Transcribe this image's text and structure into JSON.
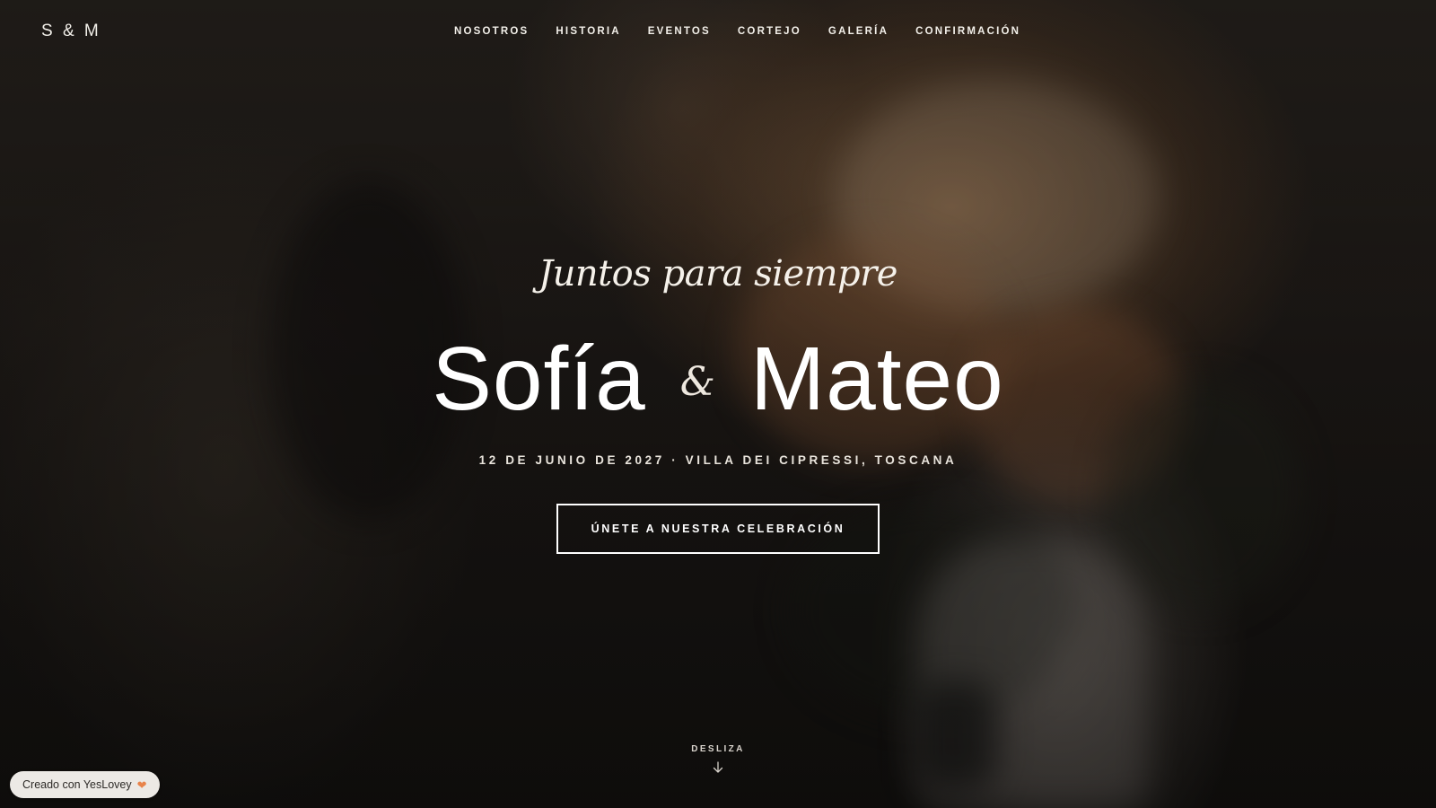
{
  "header": {
    "logo": "S & M",
    "nav": [
      {
        "label": "NOSOTROS"
      },
      {
        "label": "HISTORIA"
      },
      {
        "label": "EVENTOS"
      },
      {
        "label": "CORTEJO"
      },
      {
        "label": "GALERÍA"
      },
      {
        "label": "CONFIRMACIÓN"
      }
    ]
  },
  "hero": {
    "tagline": "Juntos para siempre",
    "name_one": "Sofía",
    "ampersand": "&",
    "name_two": "Mateo",
    "details": "12 DE JUNIO DE 2027 · VILLA DEI CIPRESSI, TOSCANA",
    "cta_label": "ÚNETE A NUESTRA CELEBRACIÓN",
    "scroll_label": "DESLIZA"
  },
  "badge": {
    "label": "Creado con YesLovey",
    "icon": "heart-icon"
  },
  "colors": {
    "text": "#ffffff",
    "badge_bg": "#ece9e5",
    "heart": "#e8834a"
  }
}
